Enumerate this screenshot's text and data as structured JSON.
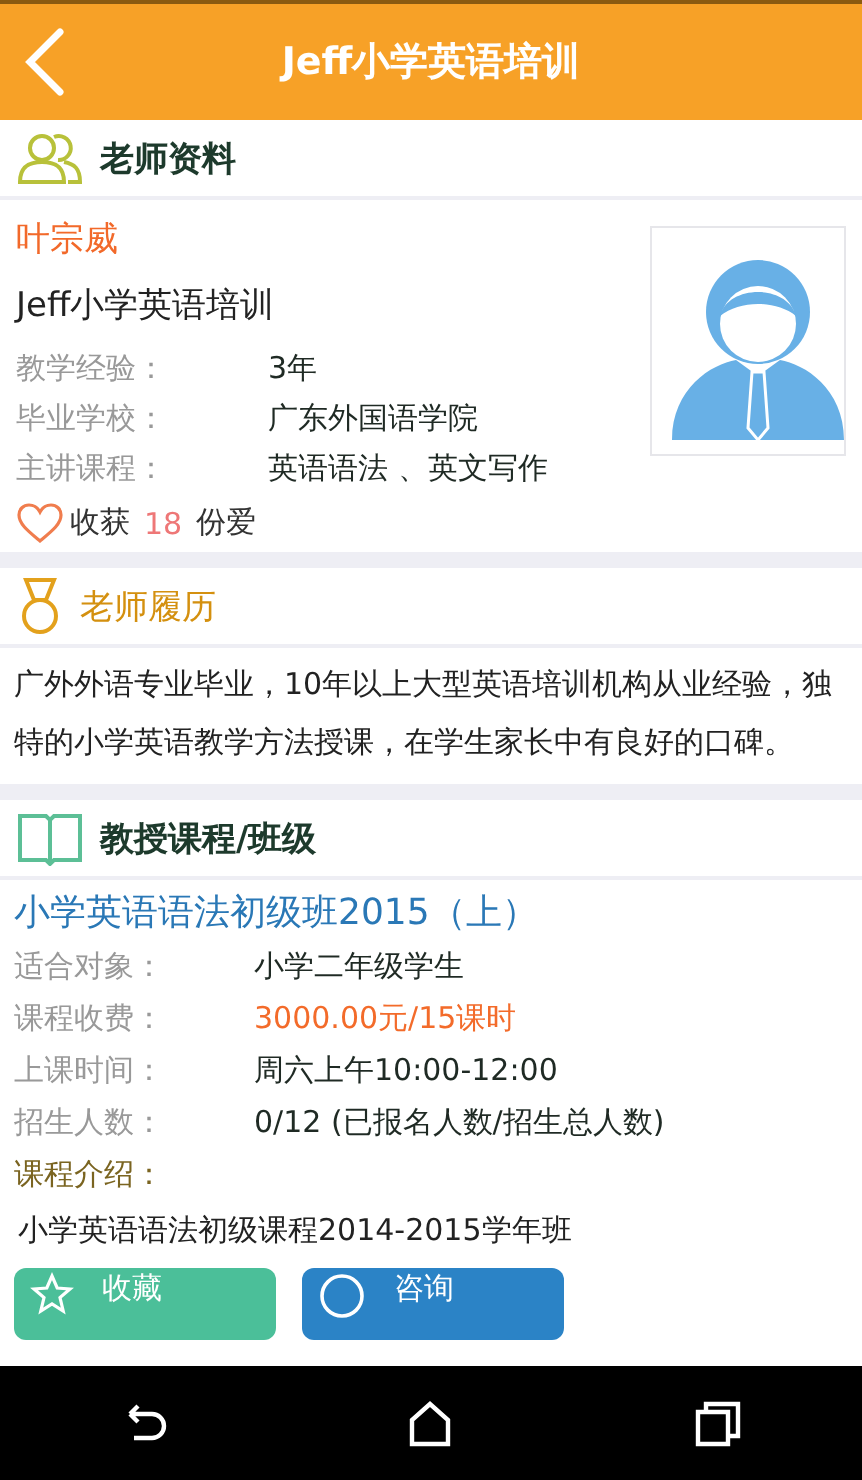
{
  "header": {
    "title": "Jeff小学英语培训"
  },
  "profile": {
    "heading": "老师资料",
    "name": "叶宗威",
    "org": "Jeff小学英语培训",
    "fields": [
      {
        "label": "教学经验：",
        "value": "3年"
      },
      {
        "label": "毕业学校：",
        "value": "广东外国语学院"
      },
      {
        "label": "主讲课程：",
        "value": "英语语法 、英文写作"
      }
    ],
    "likes": {
      "prefix": "收获",
      "count": "18",
      "suffix": "份爱"
    }
  },
  "resume": {
    "heading": "老师履历",
    "text": "广外外语专业毕业，10年以上大型英语培训机构从业经验，独特的小学英语教学方法授课，在学生家长中有良好的口碑。"
  },
  "courses": {
    "heading": "教授课程/班级",
    "items": [
      {
        "title": "小学英语语法初级班2015（上）",
        "fields": [
          {
            "label": "适合对象：",
            "value": "小学二年级学生",
            "kind": "plain"
          },
          {
            "label": "课程收费：",
            "value": "3000.00元/15课时",
            "kind": "price"
          },
          {
            "label": "上课时间：",
            "value": "周六上午10:00-12:00",
            "kind": "plain"
          },
          {
            "label": "招生人数：",
            "value": "0/12 (已报名人数/招生总人数)",
            "kind": "plain"
          }
        ],
        "intro_label": "课程介绍：",
        "intro": "小学英语语法初级课程2014-2015学年班"
      }
    ]
  },
  "actions": [
    {
      "label": "收藏",
      "kind": "favorite"
    },
    {
      "label": "咨询",
      "kind": "consult"
    }
  ]
}
